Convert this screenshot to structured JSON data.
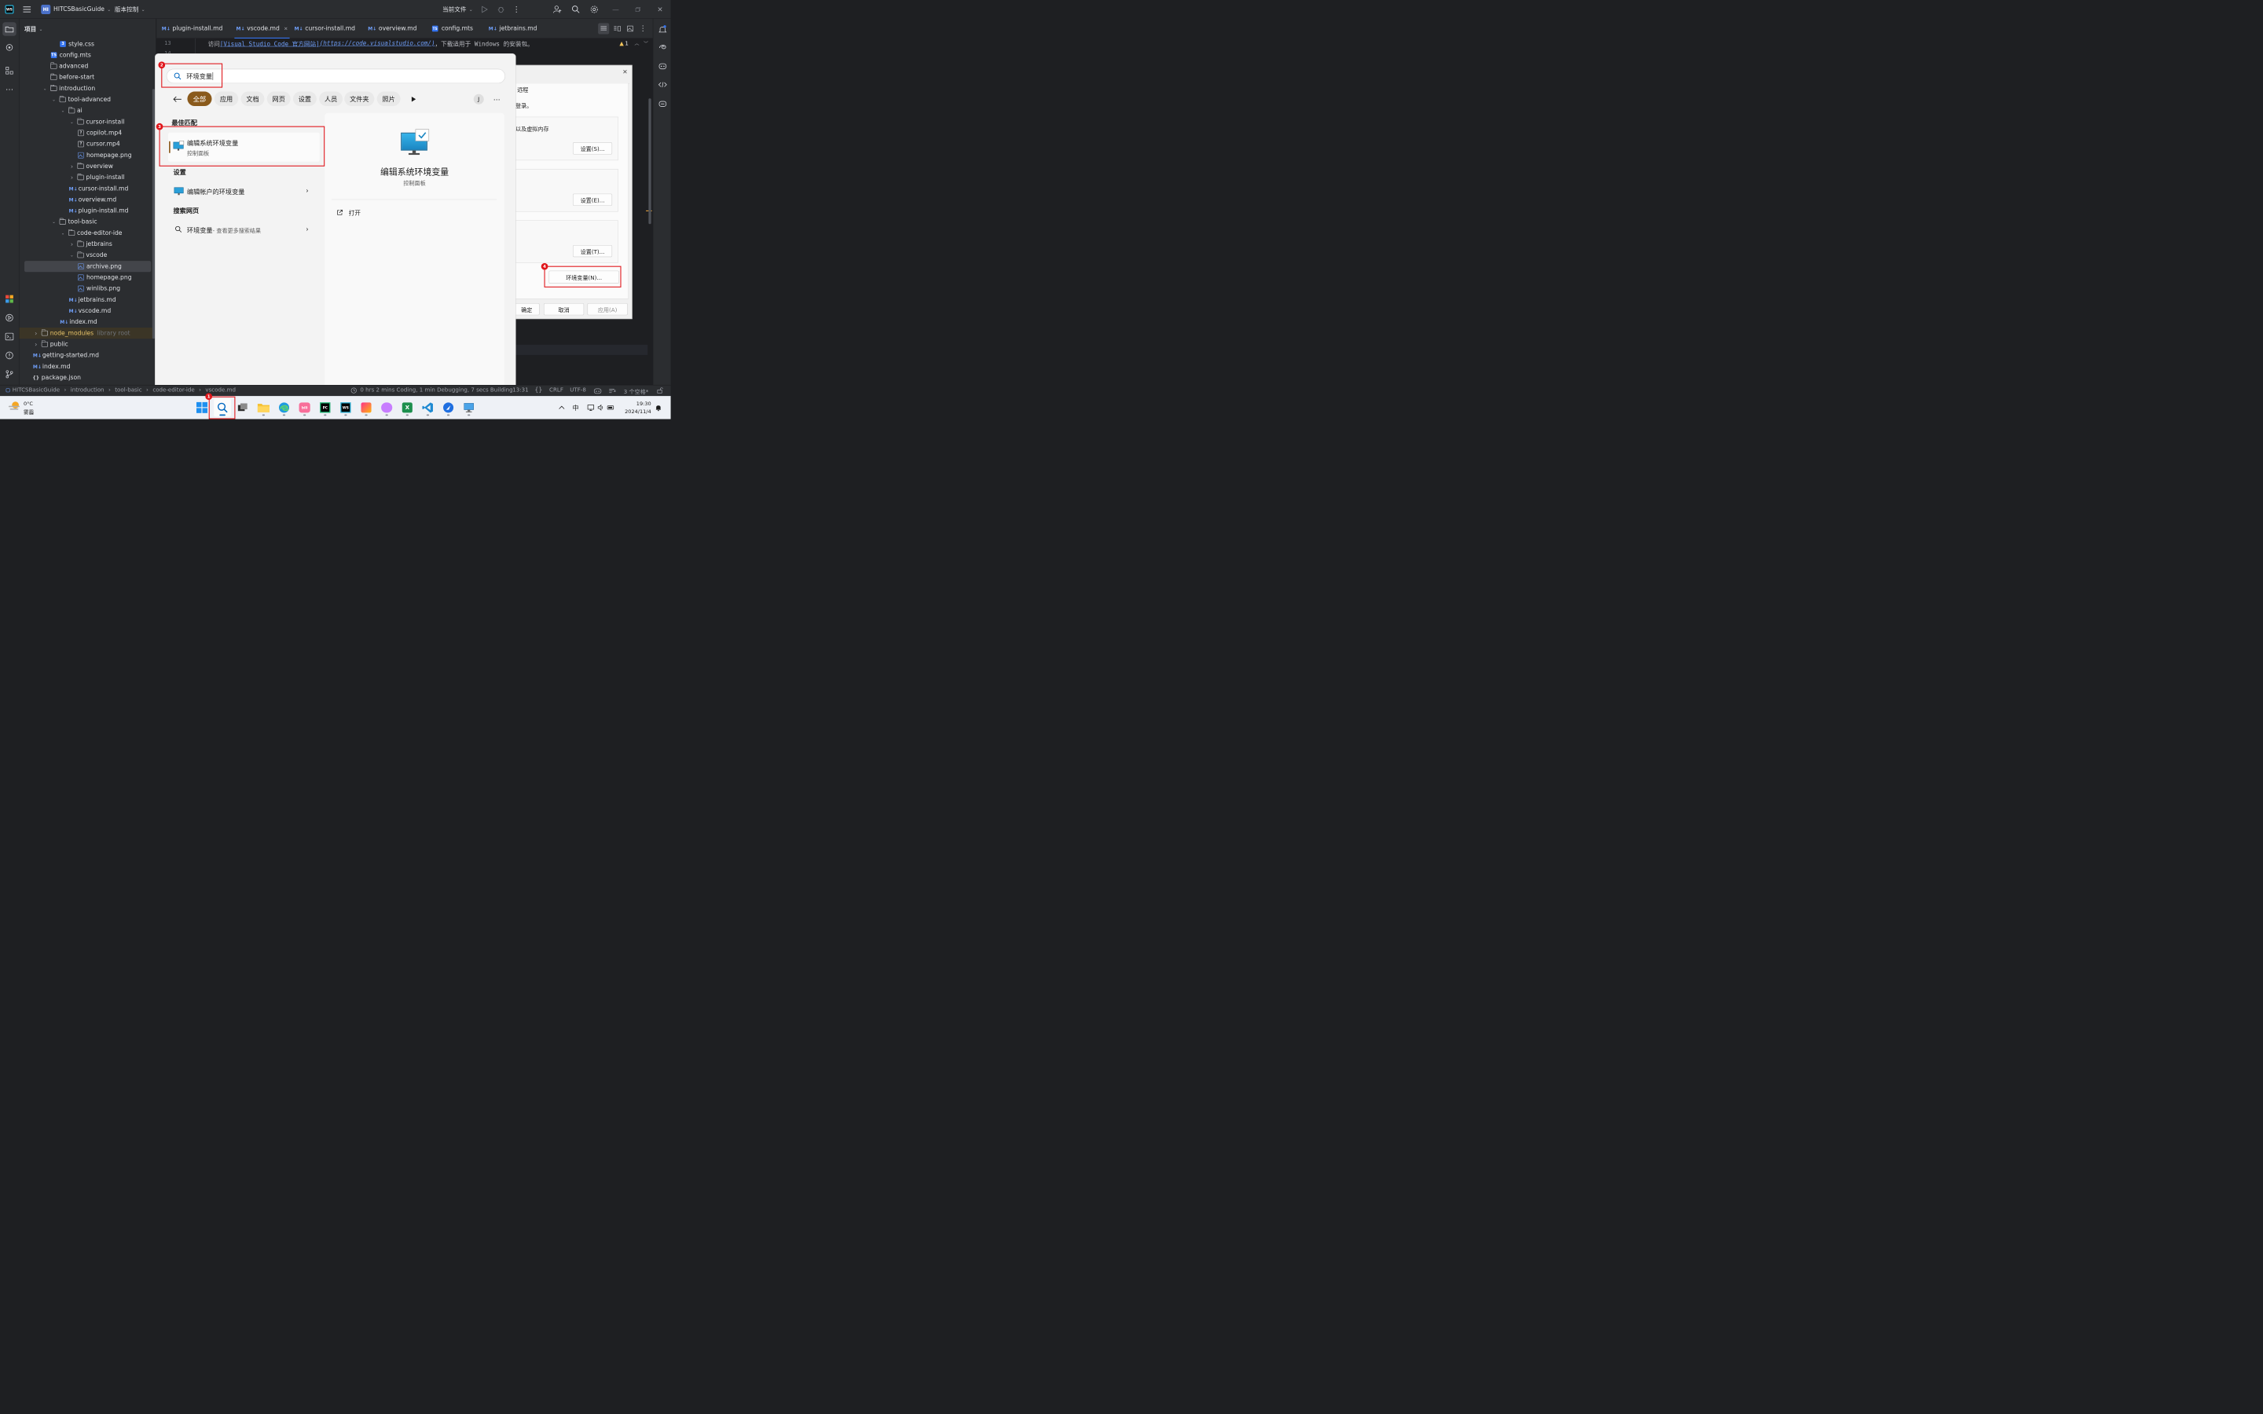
{
  "titlebar": {
    "project_badge": "HI",
    "project_name": "HITCSBasicGuide",
    "vcs_label": "版本控制",
    "current_file_label": "当前文件"
  },
  "project_panel": {
    "title": "项目",
    "items": [
      {
        "label": "style.css",
        "type": "css",
        "depth": 4
      },
      {
        "label": "config.mts",
        "type": "ts",
        "depth": 3
      },
      {
        "label": "advanced",
        "type": "folder",
        "depth": 2,
        "chevron": ""
      },
      {
        "label": "before-start",
        "type": "folder",
        "depth": 2,
        "chevron": ""
      },
      {
        "label": "introduction",
        "type": "folder",
        "depth": 2,
        "chevron": "down"
      },
      {
        "label": "tool-advanced",
        "type": "folder",
        "depth": 3,
        "chevron": "down"
      },
      {
        "label": "ai",
        "type": "folder",
        "depth": 4,
        "chevron": "down"
      },
      {
        "label": "cursor-install",
        "type": "folder",
        "depth": 5,
        "chevron": "down"
      },
      {
        "label": "copilot.mp4",
        "type": "unknown",
        "depth": 6
      },
      {
        "label": "cursor.mp4",
        "type": "unknown",
        "depth": 6
      },
      {
        "label": "homepage.png",
        "type": "image",
        "depth": 6
      },
      {
        "label": "overview",
        "type": "folder",
        "depth": 5,
        "chevron": "right"
      },
      {
        "label": "plugin-install",
        "type": "folder",
        "depth": 5,
        "chevron": "right"
      },
      {
        "label": "cursor-install.md",
        "type": "md",
        "depth": 5
      },
      {
        "label": "overview.md",
        "type": "md",
        "depth": 5
      },
      {
        "label": "plugin-install.md",
        "type": "md",
        "depth": 5
      },
      {
        "label": "tool-basic",
        "type": "folder",
        "depth": 3,
        "chevron": "down"
      },
      {
        "label": "code-editor-ide",
        "type": "folder",
        "depth": 4,
        "chevron": "down"
      },
      {
        "label": "jetbrains",
        "type": "folder",
        "depth": 5,
        "chevron": "right"
      },
      {
        "label": "vscode",
        "type": "folder",
        "depth": 5,
        "chevron": "down"
      },
      {
        "label": "archive.png",
        "type": "image",
        "depth": 6,
        "selected": true
      },
      {
        "label": "homepage.png",
        "type": "image",
        "depth": 6
      },
      {
        "label": "winlibs.png",
        "type": "image",
        "depth": 6
      },
      {
        "label": "jetbrains.md",
        "type": "md",
        "depth": 5
      },
      {
        "label": "vscode.md",
        "type": "md",
        "depth": 5
      },
      {
        "label": "index.md",
        "type": "md",
        "depth": 4
      },
      {
        "label": "node_modules",
        "type": "folder",
        "depth": 1,
        "chevron": "right",
        "suffix": "library root",
        "highlight": true
      },
      {
        "label": "public",
        "type": "folder",
        "depth": 1,
        "chevron": "right"
      },
      {
        "label": "getting-started.md",
        "type": "md",
        "depth": 1
      },
      {
        "label": "index.md",
        "type": "md",
        "depth": 1
      },
      {
        "label": "package.json",
        "type": "json",
        "depth": 1
      }
    ]
  },
  "tabs": [
    {
      "label": "plugin-install.md",
      "active": false
    },
    {
      "label": "vscode.md",
      "active": true
    },
    {
      "label": "cursor-install.md",
      "active": false
    },
    {
      "label": "overview.md",
      "active": false
    },
    {
      "label": "config.mts",
      "active": false,
      "ts": true
    },
    {
      "label": "jetbrains.md",
      "active": false
    }
  ],
  "editor": {
    "line_number": "13",
    "line_number_2": "14",
    "line_prefix": "访问 ",
    "link_text": "[Visual Studio Code 官方网站]",
    "link_url": "(https://code.visualstudio.com/)",
    "line_suffix": "，下载适用于 Windows 的安装包。",
    "warning_count": "1"
  },
  "search": {
    "query": "环境变量",
    "filters": [
      "全部",
      "应用",
      "文档",
      "网页",
      "设置",
      "人员",
      "文件夹",
      "照片"
    ],
    "user_initial": "J",
    "best_match_heading": "最佳匹配",
    "best_match_title": "编辑系统环境变量",
    "best_match_sub": "控制面板",
    "settings_heading": "设置",
    "settings_item": "编辑帐户的环境变量",
    "web_heading": "搜索网页",
    "web_item": "环境变量",
    "web_item_sub": " - 查看更多搜索结果",
    "preview_title": "编辑系统环境变量",
    "preview_sub": "控制面板",
    "open_label": "打开"
  },
  "sysdlg": {
    "tab_remote": "远程",
    "text_login": "登录。",
    "text_memory": "以及虚拟内存",
    "btn_settings_s": "设置(S)...",
    "btn_settings_e": "设置(E)...",
    "btn_settings_t": "设置(T)...",
    "btn_env": "环境变量(N)...",
    "btn_ok": "确定",
    "btn_cancel": "取消",
    "btn_apply": "应用(A)"
  },
  "annotations": [
    "1",
    "2",
    "3",
    "4"
  ],
  "statusbar": {
    "crumbs": [
      "HITCSBasicGuide",
      "introduction",
      "tool-basic",
      "code-editor-ide",
      "vscode.md"
    ],
    "wakatime": "0 hrs 2 mins Coding, 1 min Debugging, 7 secs Building",
    "position": "13:31",
    "line_sep": "CRLF",
    "encoding": "UTF-8",
    "indent": "3 个空格*"
  },
  "taskbar": {
    "weather_temp": "0°C",
    "weather_desc": "雾霾",
    "ime": "中",
    "time": "19:30",
    "date": "2024/11/4"
  },
  "colors": {
    "accent_red": "#e0161b",
    "chip_active": "#8a5a1c",
    "ide_bg": "#1e1f22",
    "ide_panel": "#2b2d30",
    "link": "#6f9ef8"
  }
}
